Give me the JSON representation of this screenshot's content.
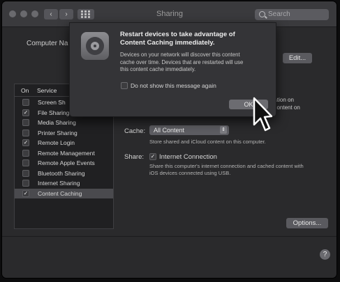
{
  "window": {
    "title": "Sharing",
    "search_placeholder": "Search",
    "back_glyph": "‹",
    "forward_glyph": "›"
  },
  "computer_name_label": "Computer Na",
  "edit_button": "Edit...",
  "right_fragments": {
    "line1": "installation on",
    "line2": "other content on"
  },
  "services": {
    "header_on": "On",
    "header_service": "Service",
    "items": [
      {
        "label": "Screen Sh",
        "checked": false,
        "selected": false
      },
      {
        "label": "File Sharing",
        "checked": true,
        "selected": false
      },
      {
        "label": "Media Sharing",
        "checked": false,
        "selected": false
      },
      {
        "label": "Printer Sharing",
        "checked": false,
        "selected": false
      },
      {
        "label": "Remote Login",
        "checked": true,
        "selected": false
      },
      {
        "label": "Remote Management",
        "checked": false,
        "selected": false
      },
      {
        "label": "Remote Apple Events",
        "checked": false,
        "selected": false
      },
      {
        "label": "Bluetooth Sharing",
        "checked": false,
        "selected": false
      },
      {
        "label": "Internet Sharing",
        "checked": false,
        "selected": false
      },
      {
        "label": "Content Caching",
        "checked": true,
        "selected": true
      }
    ]
  },
  "cache": {
    "label": "Cache:",
    "selected_value": "All Content",
    "description": "Store shared and iCloud content on this computer."
  },
  "share": {
    "label": "Share:",
    "checkbox_label": "Internet Connection",
    "checked": true,
    "description_line1": "Share this computer's internet connection and cached content with",
    "description_line2": "iOS devices connected using USB."
  },
  "options_button": "Options...",
  "help_button": "?",
  "dialog": {
    "title_line1": "Restart devices to take advantage of",
    "title_line2": "Content Caching immediately.",
    "body_line1": "Devices on your network will discover this content",
    "body_line2": "cache over time. Devices that are restarted will use",
    "body_line3": "this content cache immediately.",
    "checkbox_label": "Do not show this message again",
    "ok_button": "OK"
  },
  "icons": {
    "gear": "gear-icon",
    "search": "search-icon",
    "cursor": "pointer-cursor",
    "help": "help-icon"
  },
  "colors": {
    "window_bg": "#2a2a2c",
    "dialog_bg": "#343437",
    "selected_row": "#4a4a4e"
  }
}
